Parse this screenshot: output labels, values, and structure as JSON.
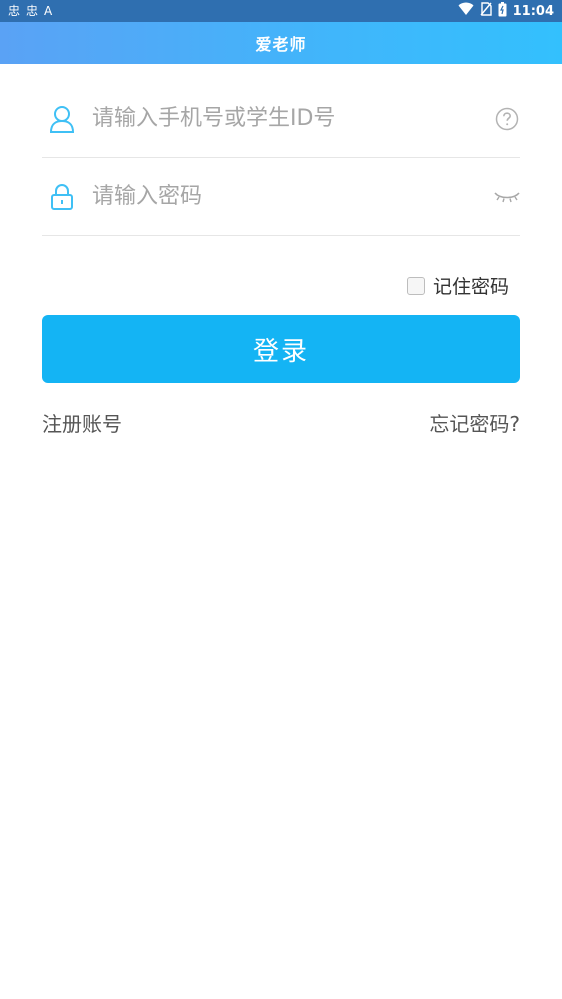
{
  "status_bar": {
    "left_glyphs": [
      "忠",
      "忠",
      "A"
    ],
    "time": "11:04"
  },
  "header": {
    "title": "爱老师"
  },
  "form": {
    "username_placeholder": "请输入手机号或学生ID号",
    "password_placeholder": "请输入密码"
  },
  "remember": {
    "label": "记住密码"
  },
  "login_button": {
    "label": "登录"
  },
  "links": {
    "register": "注册账号",
    "forgot": "忘记密码?"
  },
  "colors": {
    "accent": "#14b4f4",
    "icon": "#3fc0f5",
    "status_bar": "#2f6fb0"
  }
}
